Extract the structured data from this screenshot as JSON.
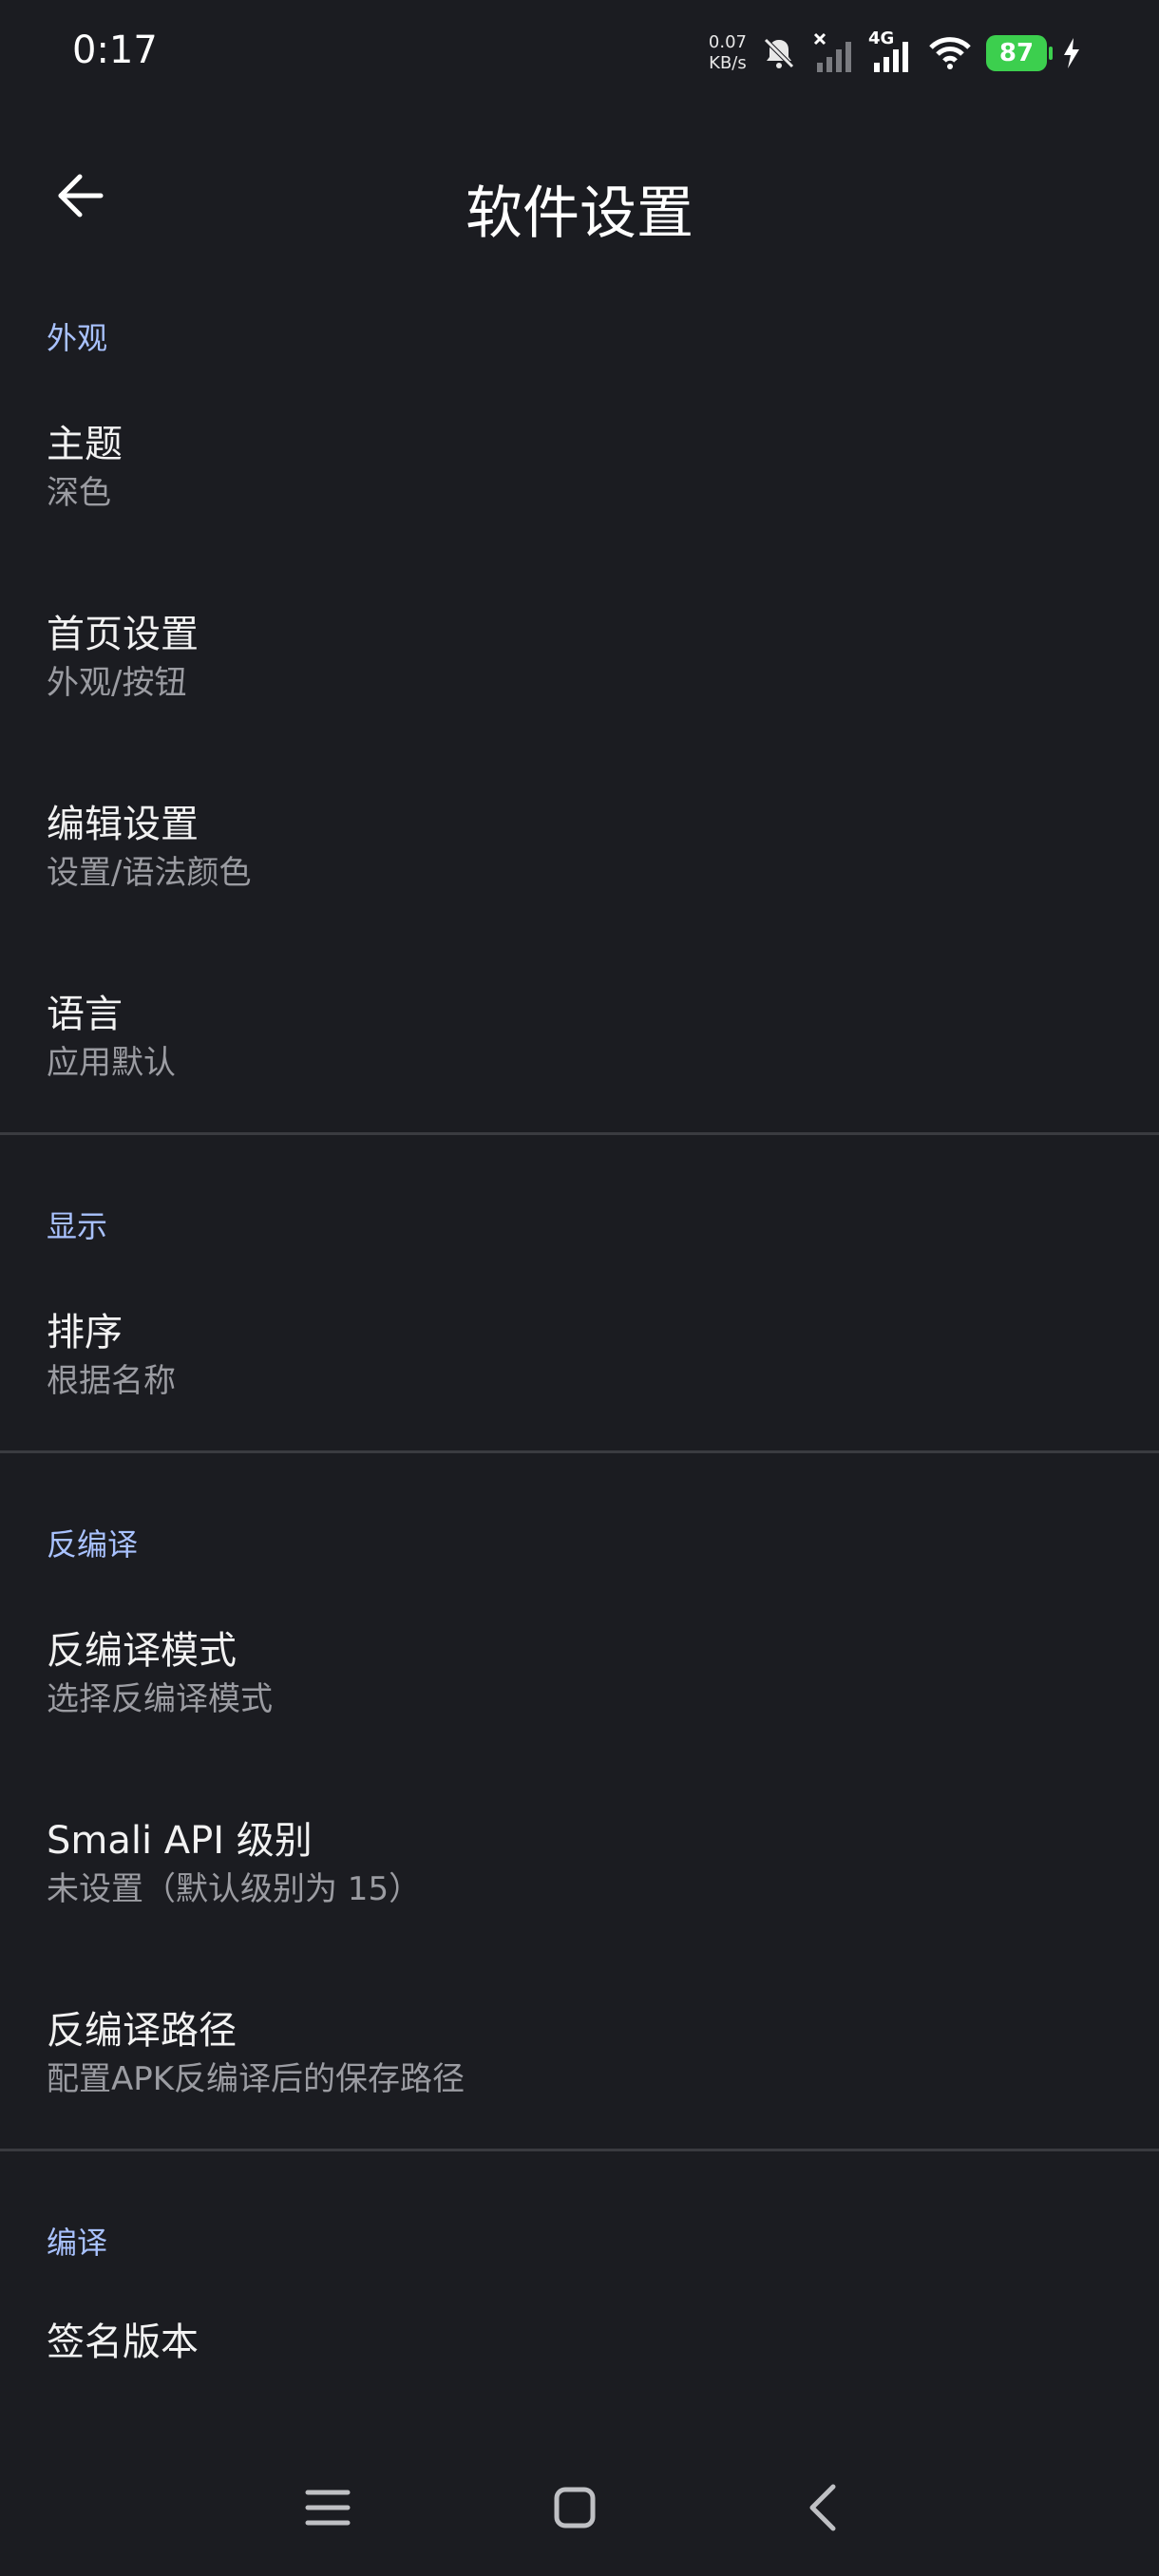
{
  "status_bar": {
    "time": "0:17",
    "net_speed_value": "0.07",
    "net_speed_unit": "KB/s",
    "network_type": "4G",
    "battery": "87"
  },
  "header": {
    "title": "软件设置"
  },
  "sections": {
    "appearance": {
      "header": "外观",
      "theme": {
        "title": "主题",
        "summary": "深色"
      },
      "home": {
        "title": "首页设置",
        "summary": "外观/按钮"
      },
      "editor": {
        "title": "编辑设置",
        "summary": "设置/语法颜色"
      },
      "language": {
        "title": "语言",
        "summary": "应用默认"
      }
    },
    "display": {
      "header": "显示",
      "sort": {
        "title": "排序",
        "summary": "根据名称"
      }
    },
    "decompile": {
      "header": "反编译",
      "mode": {
        "title": "反编译模式",
        "summary": "选择反编译模式"
      },
      "smali_api": {
        "title": "Smali API 级别",
        "summary": "未设置（默认级别为 15）"
      },
      "path": {
        "title": "反编译路径",
        "summary": "配置APK反编译后的保存路径"
      }
    },
    "compile": {
      "header": "编译",
      "signature": {
        "title": "签名版本"
      }
    }
  },
  "colors": {
    "background": "#1b1c21",
    "accent": "#a9c2ff",
    "battery": "#3ccf4e"
  },
  "icons": {
    "back": "arrow-left-icon",
    "nav_menu": "menu-icon",
    "nav_home": "home-square-icon",
    "nav_back": "chevron-left-icon"
  }
}
